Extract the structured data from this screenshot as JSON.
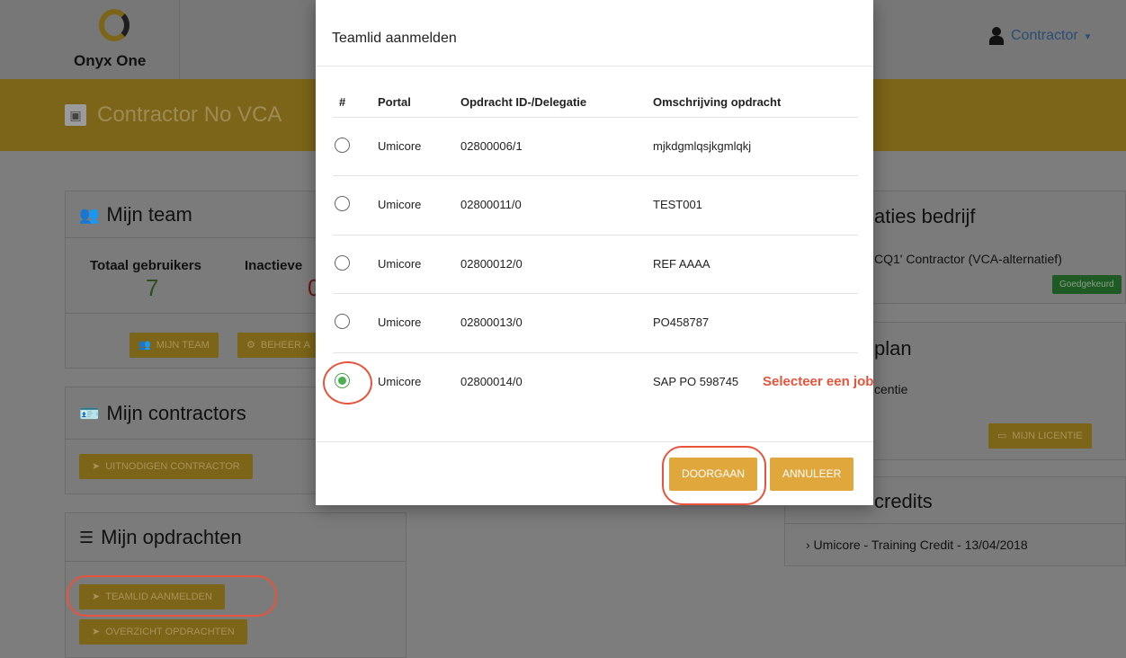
{
  "header": {
    "logo_text": "Onyx One",
    "user_label": "Contractor",
    "caret": "▾"
  },
  "banner": {
    "title": "Contractor No VCA"
  },
  "team_card": {
    "title": "Mijn team",
    "stats": [
      {
        "label": "Totaal gebruikers",
        "value": "7"
      },
      {
        "label": "Inactieve",
        "value": "0"
      }
    ],
    "buttons": [
      "MIJN TEAM",
      "BEHEER A"
    ]
  },
  "contractors_card": {
    "title": "Mijn contractors",
    "button": "UITNODIGEN CONTRACTOR"
  },
  "opdrachten_card": {
    "title": "Mijn opdrachten",
    "buttons": [
      "TEAMLID AANMELDEN",
      "OVERZICHT OPDRACHTEN"
    ]
  },
  "right_cards": {
    "kwalificaties_title": "aties bedrijf",
    "kwalificatie_item": "CQ1' Contractor (VCA-alternatief)",
    "kwalificatie_status": "Goedgekeurd",
    "plan_title": "plan",
    "plan_text": "centie",
    "licentie_button": "MIJN LICENTIE",
    "credits_title": "credits",
    "credits_item": "› Umicore  -  Training Credit  -  13/04/2018"
  },
  "modal": {
    "title": "Teamlid aanmelden",
    "columns": [
      "#",
      "Portal",
      "Opdracht ID-/Delegatie",
      "Omschrijving opdracht"
    ],
    "rows": [
      {
        "portal": "Umicore",
        "id": "02800006/1",
        "desc": "mjkdgmlqsjkgmlqkj",
        "selected": false
      },
      {
        "portal": "Umicore",
        "id": "02800011/0",
        "desc": "TEST001",
        "selected": false
      },
      {
        "portal": "Umicore",
        "id": "02800012/0",
        "desc": "REF AAAA",
        "selected": false
      },
      {
        "portal": "Umicore",
        "id": "02800013/0",
        "desc": "PO458787",
        "selected": false
      },
      {
        "portal": "Umicore",
        "id": "02800014/0",
        "desc": "SAP PO 598745",
        "selected": true
      }
    ],
    "continue_label": "DOORGAAN",
    "cancel_label": "ANNULEER"
  },
  "annotation": {
    "text": "Selecteer een job"
  },
  "colors": {
    "accent": "#e0a73c",
    "annotation": "#e8533b",
    "selected_radio": "#4caf50"
  }
}
